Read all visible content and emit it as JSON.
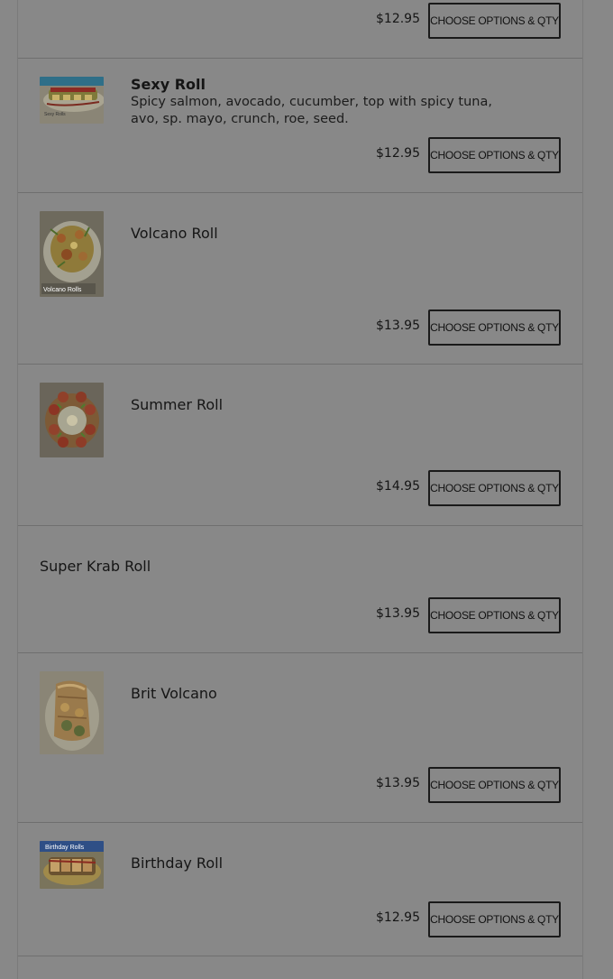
{
  "menu": {
    "items": [
      {
        "name": "",
        "description": "",
        "price": "$12.95",
        "button": "CHOOSE OPTIONS & QTY"
      },
      {
        "name": "Sexy Roll",
        "description": "Spicy salmon, avocado, cucumber, top with spicy tuna, avo, sp. mayo, crunch, roe, seed.",
        "price": "$12.95",
        "button": "CHOOSE OPTIONS & QTY",
        "image_label": "Sexy Rolls"
      },
      {
        "name": "Volcano Roll",
        "description": "",
        "price": "$13.95",
        "button": "CHOOSE OPTIONS & QTY",
        "image_label": "Volcano Rolls"
      },
      {
        "name": "Summer Roll",
        "description": "",
        "price": "$14.95",
        "button": "CHOOSE OPTIONS & QTY"
      },
      {
        "name": "Super Krab Roll",
        "description": "",
        "price": "$13.95",
        "button": "CHOOSE OPTIONS & QTY"
      },
      {
        "name": "Brit Volcano",
        "description": "",
        "price": "$13.95",
        "button": "CHOOSE OPTIONS & QTY"
      },
      {
        "name": "Birthday Roll",
        "description": "",
        "price": "$12.95",
        "button": "CHOOSE OPTIONS & QTY",
        "image_label": "Birthday Rolls"
      }
    ]
  },
  "colors": {
    "overlay_background": "#888888",
    "divider": "#6f6f6f",
    "button_border": "#1a1a1a",
    "text": "#151515"
  }
}
